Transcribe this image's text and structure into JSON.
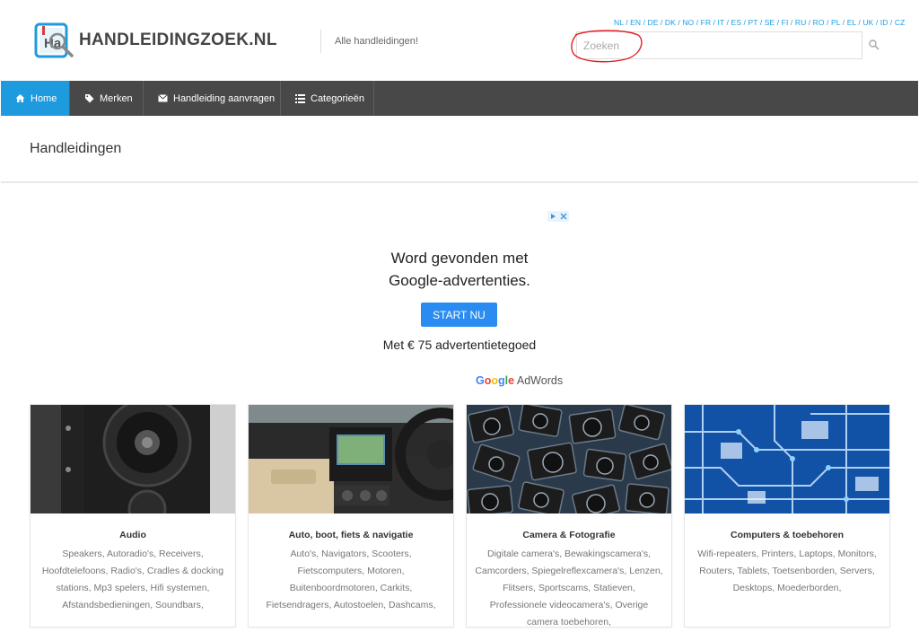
{
  "header": {
    "site_name": "HANDLEIDINGZOEK.NL",
    "tagline": "Alle handleidingen!",
    "languages": "NL / EN / DE / DK / NO / FR / IT / ES / PT / SE / FI / RU / RO / PL / EL / UK / ID / CZ",
    "search_placeholder": "Zoeken"
  },
  "nav": {
    "items": [
      {
        "label": "Home",
        "icon": "home-icon",
        "active": true
      },
      {
        "label": "Merken",
        "icon": "tag-icon"
      },
      {
        "label": "Handleiding aanvragen",
        "icon": "envelope-icon"
      },
      {
        "label": "Categorieën",
        "icon": "list-icon"
      }
    ]
  },
  "page": {
    "title": "Handleidingen"
  },
  "ad": {
    "line1": "Word gevonden met",
    "line2": "Google-advertenties.",
    "button": "START NU",
    "credit": "Met € 75 advertentietegoed",
    "brand_google": "Google",
    "brand_product": "AdWords"
  },
  "colors": {
    "accent": "#1d9bde",
    "nav_bg": "#484848",
    "ad_button": "#2a8cf0"
  },
  "categories": [
    {
      "title": "Audio",
      "text": "Speakers, Autoradio's, Receivers, Hoofdtelefoons, Radio's, Cradles & docking stations, Mp3 spelers, Hifi systemen, Afstandsbedieningen, Soundbars,"
    },
    {
      "title": "Auto, boot, fiets & navigatie",
      "text": "Auto's, Navigators, Scooters, Fietscomputers, Motoren, Buitenboordmotoren, Carkits, Fietsendragers, Autostoelen, Dashcams,"
    },
    {
      "title": "Camera & Fotografie",
      "text": "Digitale camera's, Bewakingscamera's, Camcorders, Spiegelreflexcamera's, Lenzen, Flitsers, Sportscams, Statieven, Professionele videocamera's, Overige camera toebehoren,"
    },
    {
      "title": "Computers & toebehoren",
      "text": "Wifi-repeaters, Printers, Laptops, Monitors, Routers, Tablets, Toetsenborden, Servers, Desktops, Moederborden,"
    }
  ]
}
